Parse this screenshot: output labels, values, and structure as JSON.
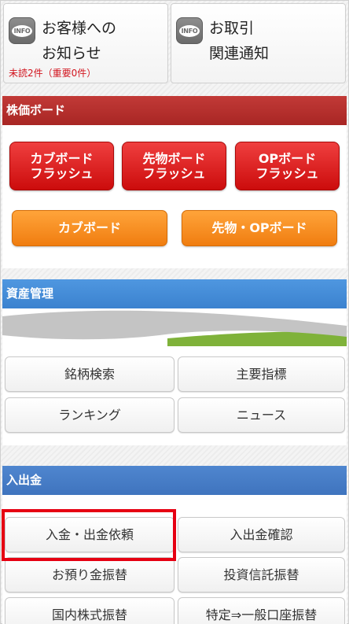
{
  "notices": [
    {
      "icon": "info-icon",
      "icon_text": "INFO",
      "line1": "お客様への",
      "line2": "お知らせ",
      "sub": "未読2件（重要0件）"
    },
    {
      "icon": "info-icon",
      "icon_text": "INFO",
      "line1": "お取引",
      "line2": "関連通知"
    }
  ],
  "stock_board": {
    "title": "株価ボード",
    "flash_buttons": [
      {
        "line1": "カブボード",
        "line2": "フラッシュ"
      },
      {
        "line1": "先物ボード",
        "line2": "フラッシュ"
      },
      {
        "line1": "OPボード",
        "line2": "フラッシュ"
      }
    ],
    "board_buttons": [
      "カブボード",
      "先物・OPボード"
    ]
  },
  "asset": {
    "title": "資産管理",
    "buttons": [
      "銘柄検索",
      "主要指標",
      "ランキング",
      "ニュース"
    ]
  },
  "inout": {
    "title": "入出金",
    "buttons": [
      "入金・出金依頼",
      "入出金確認",
      "お預り金振替",
      "投資信託振替",
      "国内株式振替",
      "特定⇒一般口座振替"
    ]
  },
  "colors": {
    "red": "#cc0c0c",
    "orange": "#f07d10",
    "blue": "#3b82cf",
    "highlight": "#e60012"
  }
}
